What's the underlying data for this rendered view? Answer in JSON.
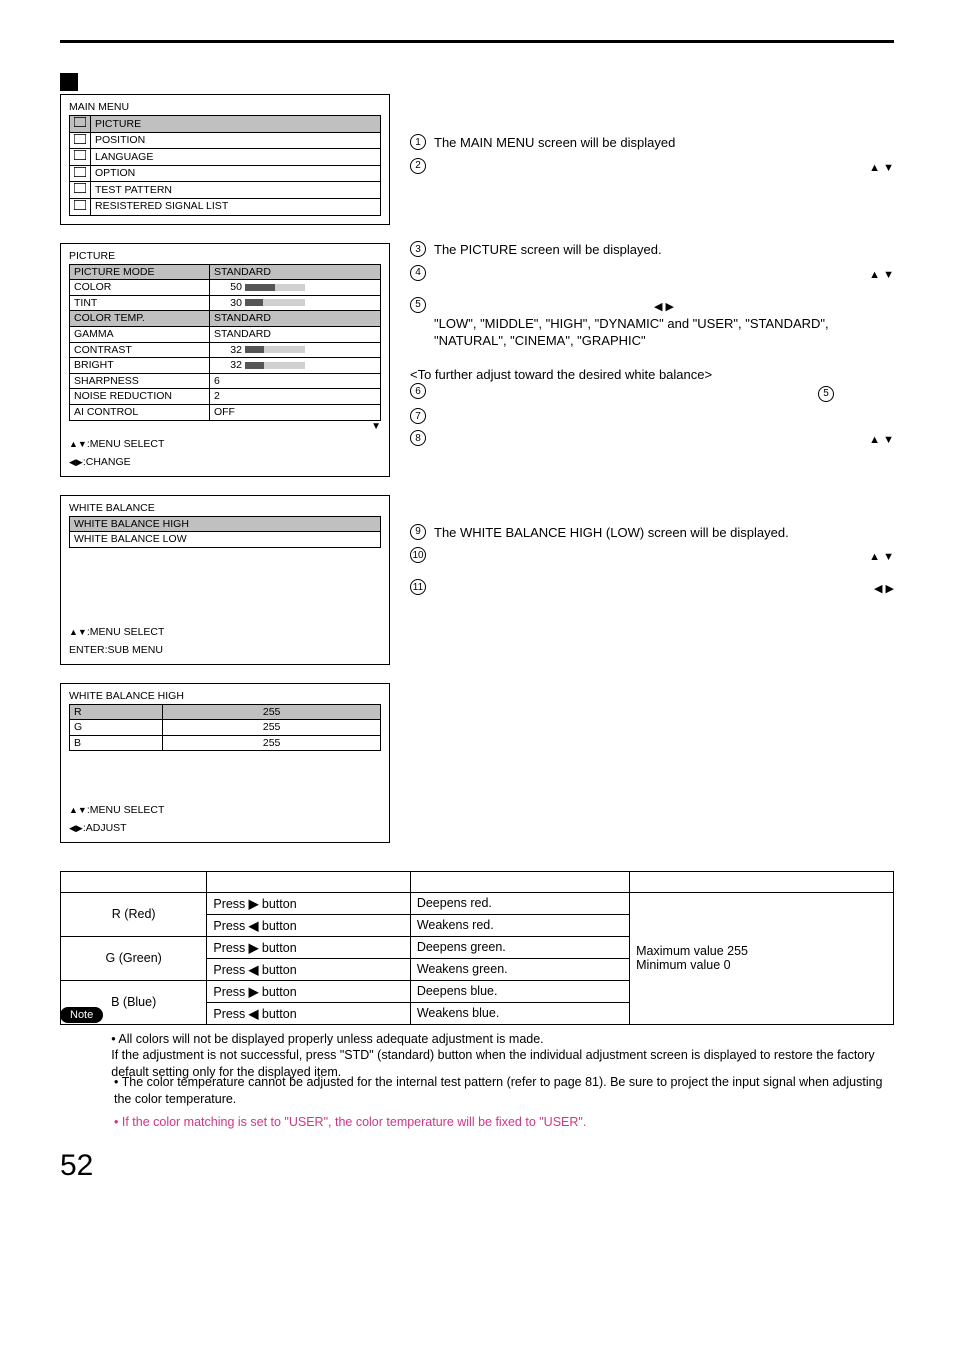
{
  "header_square": true,
  "main_menu": {
    "title": "MAIN MENU",
    "items": [
      {
        "icon": "picture-icon",
        "label": "PICTURE",
        "hl": true
      },
      {
        "icon": "position-icon",
        "label": "POSITION"
      },
      {
        "icon": "language-icon",
        "label": "LANGUAGE"
      },
      {
        "icon": "option-icon",
        "label": "OPTION"
      },
      {
        "icon": "test-icon",
        "label": "TEST PATTERN"
      },
      {
        "icon": "signal-icon",
        "label": "RESISTERED SIGNAL LIST"
      }
    ]
  },
  "picture_menu": {
    "title": "PICTURE",
    "rows": [
      {
        "label": "PICTURE MODE",
        "value": "STANDARD",
        "bar": null,
        "hl": true
      },
      {
        "label": "COLOR",
        "value": "50",
        "bar": 50
      },
      {
        "label": "TINT",
        "value": "30",
        "bar": 30
      },
      {
        "label": "COLOR TEMP.",
        "value": "STANDARD",
        "bar": null,
        "hl2": true
      },
      {
        "label": "GAMMA",
        "value": "STANDARD",
        "bar": null
      },
      {
        "label": "CONTRAST",
        "value": "32",
        "bar": 32
      },
      {
        "label": "BRIGHT",
        "value": "32",
        "bar": 32
      },
      {
        "label": "SHARPNESS",
        "value": "6",
        "bar": null
      },
      {
        "label": "NOISE REDUCTION",
        "value": "2",
        "bar": null
      },
      {
        "label": "AI CONTROL",
        "value": "OFF",
        "bar": null
      }
    ],
    "legend1": ":MENU SELECT",
    "legend2": ":CHANGE"
  },
  "wb_menu": {
    "title": "WHITE BALANCE",
    "items": [
      {
        "label": "WHITE BALANCE HIGH",
        "hl": true
      },
      {
        "label": "WHITE BALANCE LOW"
      }
    ],
    "legend1": ":MENU SELECT",
    "legend2": "ENTER:SUB MENU"
  },
  "wbh_menu": {
    "title": "WHITE BALANCE HIGH",
    "rows": [
      {
        "label": "R",
        "value": "255",
        "hl": true
      },
      {
        "label": "G",
        "value": "255"
      },
      {
        "label": "B",
        "value": "255"
      }
    ],
    "legend1": ":MENU SELECT",
    "legend2": ":ADJUST"
  },
  "steps": {
    "s1_body": "The MAIN MENU screen will be displayed",
    "s3_body": "The PICTURE screen will be displayed.",
    "s5_list": "\"LOW\", \"MIDDLE\", \"HIGH\", \"DYNAMIC\" and \"USER\", \"STANDARD\", \"NATURAL\", \"CINEMA\", \"GRAPHIC\"",
    "sub_header": "<To further adjust toward the desired white balance>",
    "s9_body": "The WHITE BALANCE HIGH (LOW) screen will be displayed."
  },
  "adjust_table": {
    "rows": [
      {
        "item": "R (Red)",
        "ops": [
          [
            "▶",
            "Deepens red."
          ],
          [
            "◀",
            "Weakens red."
          ]
        ]
      },
      {
        "item": "G (Green)",
        "ops": [
          [
            "▶",
            "Deepens green."
          ],
          [
            "◀",
            "Weakens green."
          ]
        ]
      },
      {
        "item": "B (Blue)",
        "ops": [
          [
            "▶",
            "Deepens blue."
          ],
          [
            "◀",
            "Weakens blue."
          ]
        ]
      }
    ],
    "range": "Maximum value 255\nMinimum value 0"
  },
  "notes": {
    "badge": "Note",
    "n1": "• All colors will not be displayed properly unless adequate adjustment is made.\nIf the adjustment is not successful, press \"STD\" (standard) button when the individual adjustment screen is displayed to restore the factory default setting only for the displayed item.",
    "n2": "• The color temperature cannot be adjusted for the internal test pattern (refer to page 81).  Be sure to project the input signal when adjusting the color temperature.",
    "n3": "• If the color matching is set to \"USER\", the color temperature will be fixed to \"USER\"."
  },
  "page": "52"
}
